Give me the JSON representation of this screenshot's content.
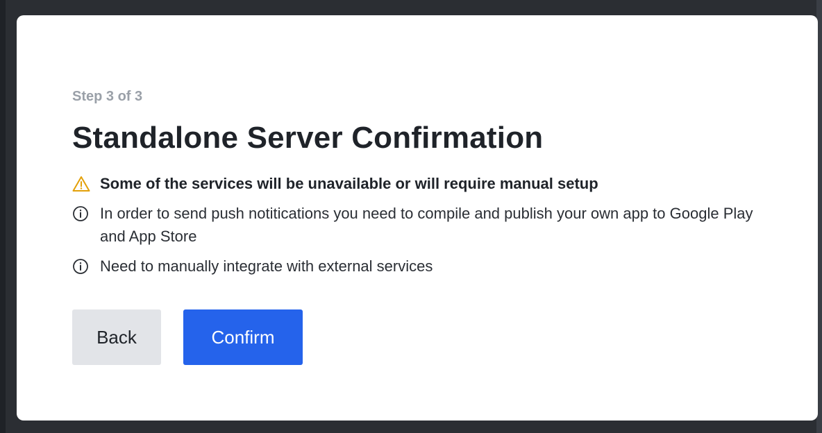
{
  "dialog": {
    "step_label": "Step 3 of 3",
    "title": "Standalone Server Confirmation",
    "notices": [
      {
        "icon": "warning-icon",
        "text": "Some of the services will be unavailable or will require manual setup"
      },
      {
        "icon": "info-icon",
        "text": "In order to send push notitications you need to compile and publish your own app to Google Play and App Store"
      },
      {
        "icon": "info-icon",
        "text": "Need to manually integrate with external services"
      }
    ],
    "buttons": {
      "back_label": "Back",
      "confirm_label": "Confirm"
    }
  },
  "colors": {
    "warning": "#e3a008",
    "primary": "#2563eb",
    "secondary_bg": "#e2e4e8",
    "backdrop": "#2b2e33"
  }
}
